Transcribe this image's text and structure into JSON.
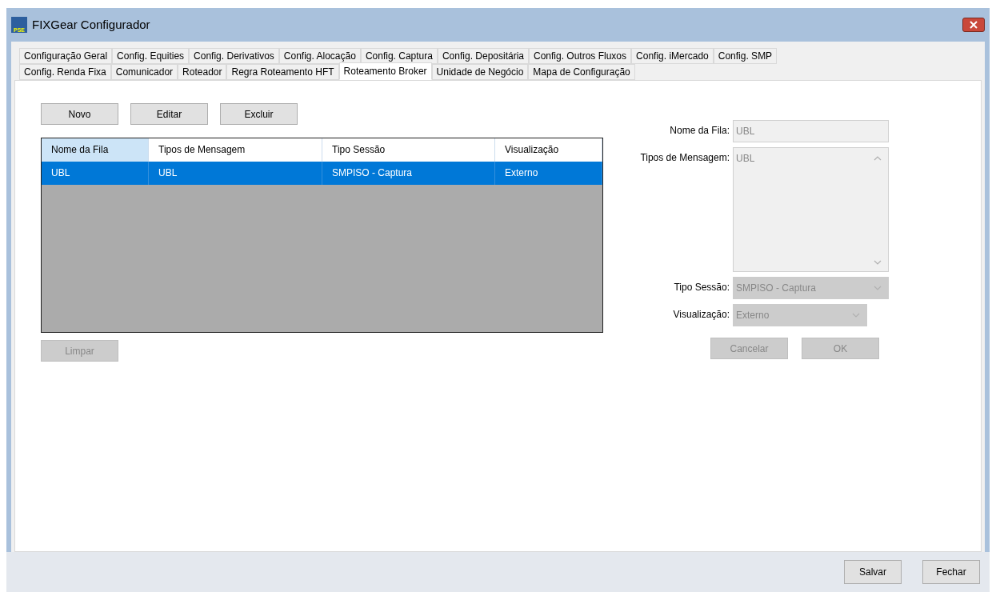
{
  "window": {
    "title": "FIXGear Configurador",
    "logo_text": "PSE"
  },
  "tab_rows": [
    [
      {
        "label": "Configuração Geral",
        "selected": false
      },
      {
        "label": "Config. Equities",
        "selected": false
      },
      {
        "label": "Config. Derivativos",
        "selected": false
      },
      {
        "label": "Config. Alocação",
        "selected": false
      },
      {
        "label": "Config. Captura",
        "selected": false
      },
      {
        "label": "Config. Depositária",
        "selected": false
      },
      {
        "label": "Config. Outros Fluxos",
        "selected": false
      },
      {
        "label": "Config. iMercado",
        "selected": false
      },
      {
        "label": "Config. SMP",
        "selected": false
      }
    ],
    [
      {
        "label": "Config. Renda Fixa",
        "selected": false
      },
      {
        "label": "Comunicador",
        "selected": false
      },
      {
        "label": "Roteador",
        "selected": false
      },
      {
        "label": "Regra Roteamento HFT",
        "selected": false
      },
      {
        "label": "Roteamento Broker",
        "selected": true
      },
      {
        "label": "Unidade de Negócio",
        "selected": false
      },
      {
        "label": "Mapa de Configuração",
        "selected": false
      }
    ]
  ],
  "toolbar": [
    {
      "label": "Novo",
      "disabled": false
    },
    {
      "label": "Editar",
      "disabled": false
    },
    {
      "label": "Excluir",
      "disabled": false
    }
  ],
  "table": {
    "columns": [
      "Nome da Fila",
      "Tipos de Mensagem",
      "Tipo Sessão",
      "Visualização"
    ],
    "rows": [
      {
        "cells": [
          "UBL",
          "UBL",
          "SMPISO - Captura",
          "Externo"
        ],
        "selected": true
      }
    ]
  },
  "clear_button": {
    "label": "Limpar",
    "disabled": true
  },
  "form": {
    "fields": [
      {
        "kind": "text",
        "label": "Nome da Fila:",
        "value": "UBL",
        "disabled": true
      },
      {
        "kind": "textarea",
        "label": "Tipos de Mensagem:",
        "value": "UBL",
        "disabled": true
      },
      {
        "kind": "select",
        "label": "Tipo Sessão:",
        "value": "SMPISO - Captura",
        "disabled": true
      },
      {
        "kind": "select-short",
        "label": "Visualização:",
        "value": "Externo",
        "disabled": true
      }
    ],
    "buttons": [
      {
        "label": "Cancelar",
        "disabled": true
      },
      {
        "label": "OK",
        "disabled": true
      }
    ]
  },
  "footer_buttons": [
    {
      "label": "Salvar",
      "disabled": false
    },
    {
      "label": "Fechar",
      "disabled": false
    }
  ]
}
